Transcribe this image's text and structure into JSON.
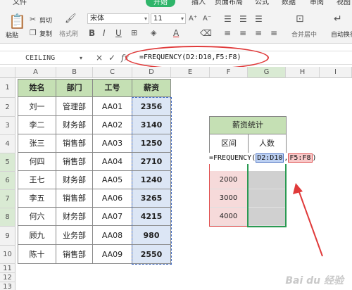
{
  "ribbon": {
    "menus": [
      "文件",
      "开始",
      "插入",
      "页面布局",
      "公式",
      "数据",
      "审阅",
      "视图"
    ],
    "paste": "粘贴",
    "cut": "剪切",
    "copy": "复制",
    "format_painter": "格式刷",
    "font_name": "宋体",
    "font_size": "11",
    "bold": "B",
    "italic": "I",
    "underline": "U",
    "font_color": "A",
    "merge_center": "合并居中",
    "auto_wrap": "自动换行"
  },
  "formula_bar": {
    "name_box": "CEILING",
    "cancel": "×",
    "confirm": "✓",
    "fx": "fx",
    "formula": "=FREQUENCY(D2:D10,F5:F8)"
  },
  "columns": [
    "A",
    "B",
    "C",
    "D",
    "E",
    "F",
    "G",
    "H",
    "I"
  ],
  "rows": [
    "1",
    "2",
    "3",
    "4",
    "5",
    "6",
    "7",
    "8",
    "9",
    "10",
    "11",
    "12",
    "13"
  ],
  "table": {
    "headers": [
      "姓名",
      "部门",
      "工号",
      "薪资"
    ],
    "rows": [
      [
        "刘一",
        "管理部",
        "AA01",
        "2356"
      ],
      [
        "李二",
        "财务部",
        "AA02",
        "3140"
      ],
      [
        "张三",
        "销售部",
        "AA03",
        "1250"
      ],
      [
        "何四",
        "销售部",
        "AA04",
        "2710"
      ],
      [
        "王七",
        "财务部",
        "AA05",
        "1240"
      ],
      [
        "李五",
        "销售部",
        "AA06",
        "3265"
      ],
      [
        "何六",
        "财务部",
        "AA07",
        "4215"
      ],
      [
        "顾九",
        "业务部",
        "AA08",
        "980"
      ],
      [
        "陈十",
        "销售部",
        "AA09",
        "2550"
      ]
    ]
  },
  "stats": {
    "title": "薪资统计",
    "col1": "区间",
    "col2": "人数",
    "formula_prefix": "=FREQUENCY(",
    "ref1": "D2:D10",
    "sep": ",",
    "ref2": "F5:F8",
    "formula_suffix": ")",
    "intervals": [
      "2000",
      "3000",
      "4000"
    ]
  },
  "watermark": "Bai du 经验",
  "colors": {
    "accent": "#2fb56a",
    "header_fill": "#c5e0b4",
    "salary_fill": "#dce6f5",
    "interval_fill": "#f6dada",
    "annotation": "#e03a3a"
  }
}
